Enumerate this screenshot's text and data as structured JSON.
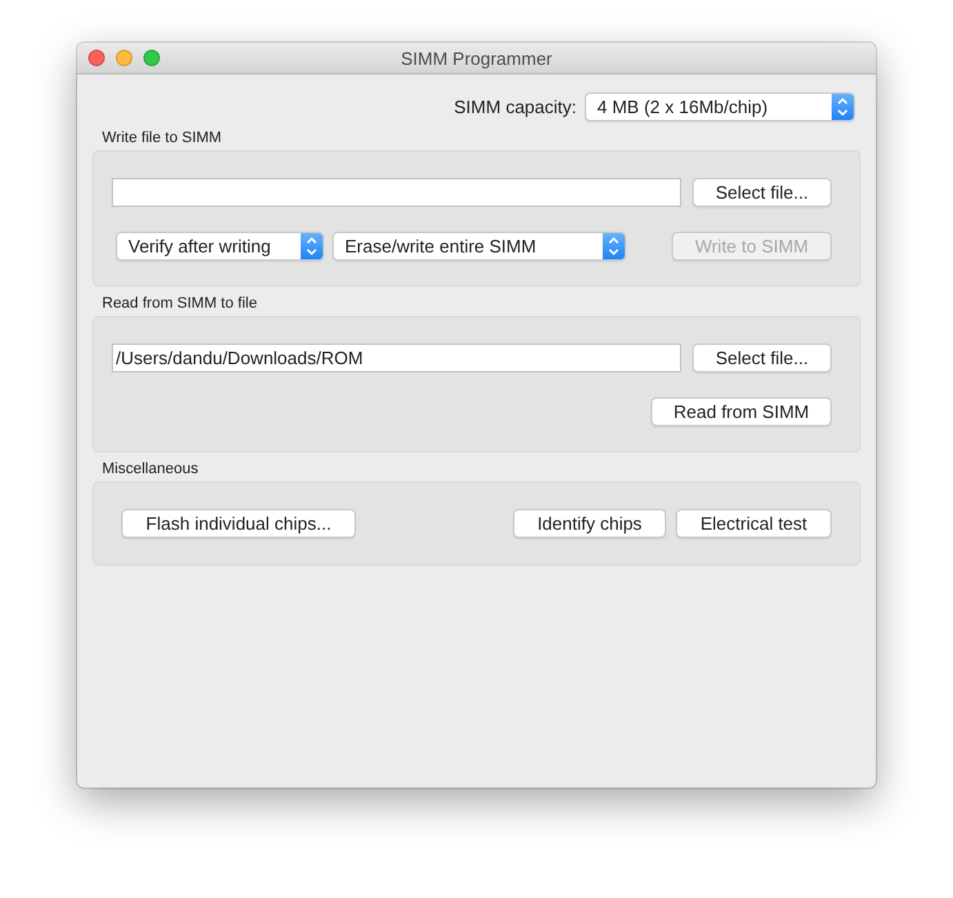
{
  "window": {
    "title": "SIMM Programmer"
  },
  "capacity": {
    "label": "SIMM capacity:",
    "value": "4 MB (2 x 16Mb/chip)"
  },
  "write_section": {
    "title": "Write file to SIMM",
    "select_button": {
      "label": "Select file...",
      "disabled": false
    },
    "verify_popup": {
      "value": "Verify after writing"
    },
    "mode_popup": {
      "value": "Erase/write entire SIMM"
    },
    "write_button": {
      "label": "Write to SIMM",
      "disabled": true
    }
  },
  "read_section": {
    "title": "Read from SIMM to file",
    "path_field": {
      "value": "/Users/dandu/Downloads/ROM"
    },
    "select_button": {
      "label": "Select file...",
      "disabled": false
    },
    "read_button": {
      "label": "Read from SIMM",
      "disabled": false
    }
  },
  "misc_section": {
    "title": "Miscellaneous",
    "buttons": [
      {
        "label": "Flash individual chips...",
        "disabled": false
      },
      {
        "label": "Identify chips",
        "disabled": false
      },
      {
        "label": "Electrical test",
        "disabled": false
      }
    ]
  }
}
